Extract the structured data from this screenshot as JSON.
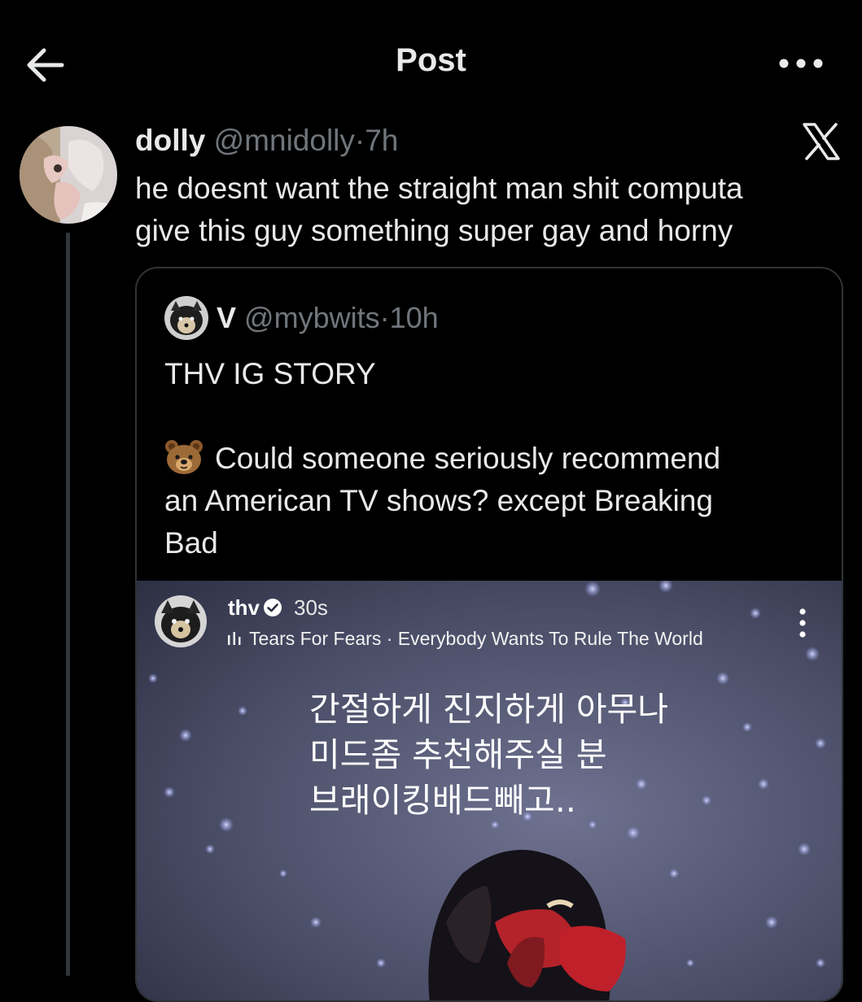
{
  "header": {
    "title": "Post"
  },
  "post": {
    "author_name": "dolly",
    "author_handle": "@mnidolly",
    "separator": "·",
    "time": "7h",
    "text_lines": [
      "he doesnt want the straight man shit computa",
      "give this guy something super gay and horny"
    ]
  },
  "quote": {
    "author_name": "V",
    "author_handle": "@mybwits",
    "separator": "·",
    "time": "10h",
    "lines": [
      "THV IG STORY",
      "",
      "Could someone seriously recommend",
      "an American TV shows? except Breaking",
      "Bad"
    ],
    "emoji": "bear-face-emoji",
    "story": {
      "username": "thv",
      "age": "30s",
      "music": "Tears For Fears · Everybody Wants To Rule The World",
      "korean_lines": [
        "간절하게 진지하게 아무나",
        "미드좀 추천해주실 분",
        "브래이킹배드빼고.."
      ]
    }
  },
  "icons": {
    "back": "arrow-left-icon",
    "more": "more-horizontal-icon",
    "platform": "x-logo-icon",
    "verified": "verified-badge-icon",
    "music": "music-bars-icon",
    "story_more": "more-vertical-icon"
  },
  "colors": {
    "background": "#000000",
    "text_primary": "#e7e9ea",
    "text_secondary": "#71767b",
    "border": "#2f3336",
    "story_accent_red": "#c0202a"
  }
}
